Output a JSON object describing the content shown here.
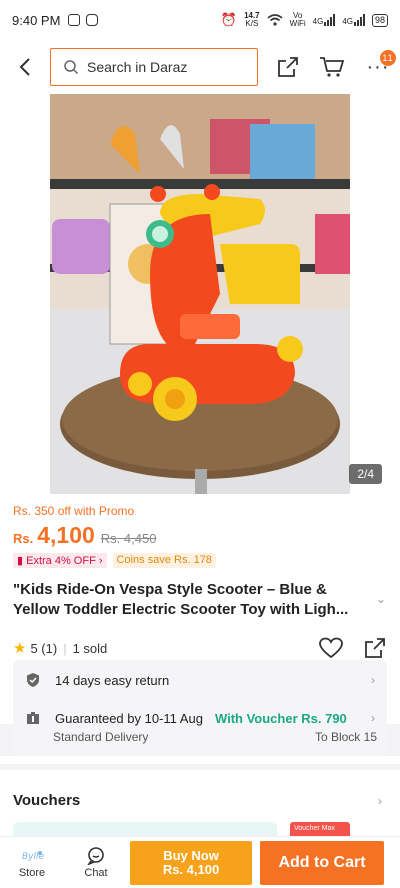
{
  "status": {
    "time": "9:40 PM",
    "speed": "14.7",
    "speed_unit": "K/S",
    "vowifi_top": "Vo",
    "vowifi_bottom": "WiFi",
    "net1": "4G",
    "net2": "4G",
    "battery": "98"
  },
  "header": {
    "search_placeholder": "Search in Daraz",
    "cart_badge": "11"
  },
  "gallery": {
    "counter": "2/4"
  },
  "price": {
    "promo": "Rs. 350 off with Promo",
    "currency": "Rs.",
    "current": "4,100",
    "original": "Rs. 4,450",
    "extra_tag": "Extra 4% OFF",
    "coins_tag": "Coins save Rs. 178"
  },
  "product": {
    "title": "\"Kids Ride-On Vespa Style Scooter – Blue & Yellow Toddler Electric Scooter Toy with Ligh...",
    "rating": "5 (1)",
    "sold": "1 sold"
  },
  "service": {
    "return_label": "14 days easy return",
    "guarantee_label": "Guaranteed by 10-11 Aug",
    "voucher_label": "With Voucher Rs. 790",
    "delivery_type": "Standard Delivery",
    "destination": "To Block 15"
  },
  "vouchers": {
    "heading": "Vouchers",
    "max_tag": "Voucher Max"
  },
  "bottom": {
    "store": "Store",
    "chat": "Chat",
    "buy_now_line1": "Buy Now",
    "buy_now_line2": "Rs. 4,100",
    "add_to_cart": "Add to Cart"
  },
  "colors": {
    "accent": "#f57224",
    "buy_now": "#f7a21b",
    "voucher_green": "#1aa885"
  },
  "icons": [
    "back-arrow-icon",
    "search-icon",
    "share-icon",
    "cart-icon",
    "more-icon",
    "star-icon",
    "heart-icon",
    "return-shield-icon",
    "delivery-icon",
    "store-icon",
    "chat-icon"
  ]
}
